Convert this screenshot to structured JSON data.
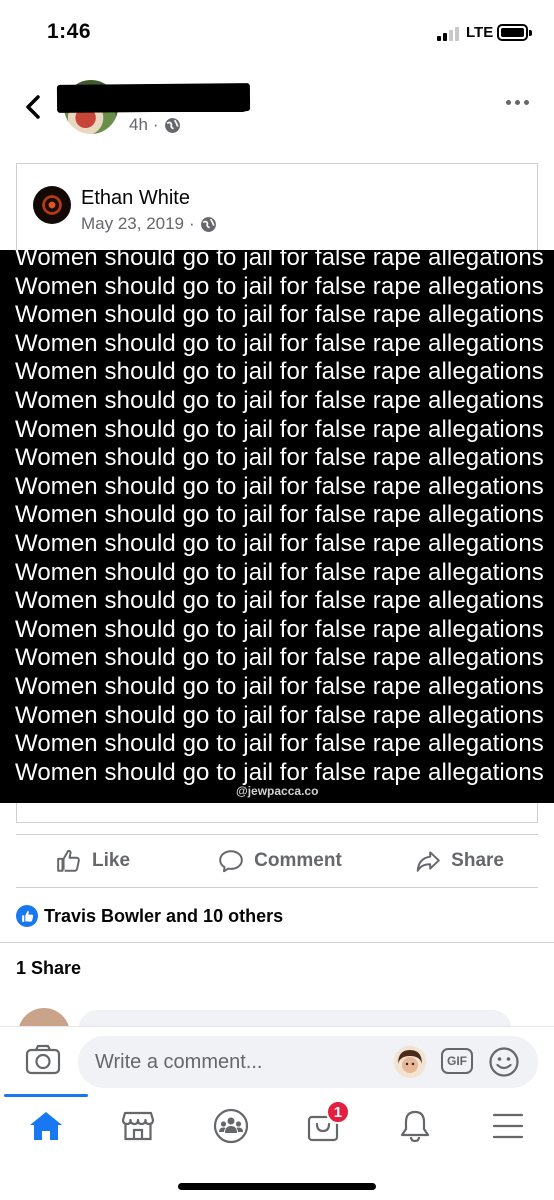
{
  "status_bar": {
    "time": "1:46",
    "network": "LTE"
  },
  "post": {
    "time_ago": "4h",
    "time_separator": "·"
  },
  "shared_post": {
    "author": "Ethan White",
    "date": "May 23, 2019",
    "date_separator": "·",
    "image_lines": [
      "Women should go to jail for false rape allegations",
      "Women should go to jail for false rape allegations",
      "Women should go to jail for false rape allegations",
      "Women should go to jail for false rape allegations",
      "Women should go to jail for false rape allegations",
      "Women should go to jail for false rape allegations",
      "Women should go to jail for false rape allegations",
      "Women should go to jail for false rape allegations",
      "Women should go to jail for false rape allegations",
      "Women should go to jail for false rape allegations",
      "Women should go to jail for false rape allegations",
      "Women should go to jail for false rape allegations",
      "Women should go to jail for false rape allegations",
      "Women should go to jail for false rape allegations",
      "Women should go to jail for false rape allegations",
      "Women should go to jail for false rape allegations",
      "Women should go to jail for false rape allegations",
      "Women should go to jail for false rape allegations",
      "Women should go to jail for false rape allegations"
    ],
    "watermark": "@jewpacca.co"
  },
  "actions": {
    "like": "Like",
    "comment": "Comment",
    "share": "Share"
  },
  "reactions": {
    "summary": "Travis Bowler and 10 others"
  },
  "shares": {
    "label": "1 Share"
  },
  "composer": {
    "placeholder": "Write a comment...",
    "gif_label": "GIF"
  },
  "tab_bar": {
    "notifications_badge": "1"
  },
  "colors": {
    "accent": "#1877f2",
    "badge": "#e41e3f",
    "muted": "#65676b"
  }
}
